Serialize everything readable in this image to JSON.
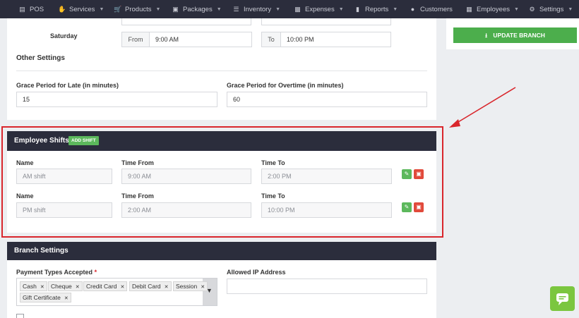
{
  "nav": {
    "items": [
      {
        "label": "POS",
        "icon": "pos-icon",
        "caret": false
      },
      {
        "label": "Services",
        "icon": "hand-icon",
        "caret": true
      },
      {
        "label": "Products",
        "icon": "cart-icon",
        "caret": true
      },
      {
        "label": "Packages",
        "icon": "box-icon",
        "caret": true
      },
      {
        "label": "Inventory",
        "icon": "list-icon",
        "caret": true
      },
      {
        "label": "Expenses",
        "icon": "money-icon",
        "caret": true
      },
      {
        "label": "Reports",
        "icon": "bar-chart-icon",
        "caret": true
      },
      {
        "label": "Customers",
        "icon": "users-icon",
        "caret": false
      },
      {
        "label": "Employees",
        "icon": "briefcase-icon",
        "caret": true
      },
      {
        "label": "Settings",
        "icon": "gear-icon",
        "caret": true
      }
    ]
  },
  "hours": {
    "saturday_label": "Saturday",
    "from_label": "From",
    "to_label": "To",
    "saturday_from": "9:00 AM",
    "saturday_to": "10:00 PM"
  },
  "other_settings": {
    "title": "Other Settings",
    "grace_late_label": "Grace Period for Late (in minutes)",
    "grace_late_value": "15",
    "grace_overtime_label": "Grace Period for Overtime (in minutes)",
    "grace_overtime_value": "60"
  },
  "shifts": {
    "title": "Employee Shifts",
    "add_label": "ADD SHIFT",
    "name_label": "Name",
    "from_label": "Time From",
    "to_label": "Time To",
    "rows": [
      {
        "name": "AM shift",
        "from": "9:00 AM",
        "to": "2:00 PM"
      },
      {
        "name": "PM shift",
        "from": "2:00 AM",
        "to": "10:00 PM"
      }
    ]
  },
  "branch": {
    "title": "Branch Settings",
    "payment_label": "Payment Types Accepted",
    "required_mark": "*",
    "payment_types": [
      "Cash",
      "Cheque",
      "Credit Card",
      "Debit Card",
      "Session",
      "Gift Certificate"
    ],
    "ip_label": "Allowed IP Address",
    "ip_value": ""
  },
  "sidebar": {
    "update_label": "UPDATE BRANCH"
  },
  "colors": {
    "nav_bg": "#2b2d3c",
    "green": "#5cb85c",
    "red": "#e14a3b",
    "highlight": "#d9262c"
  }
}
